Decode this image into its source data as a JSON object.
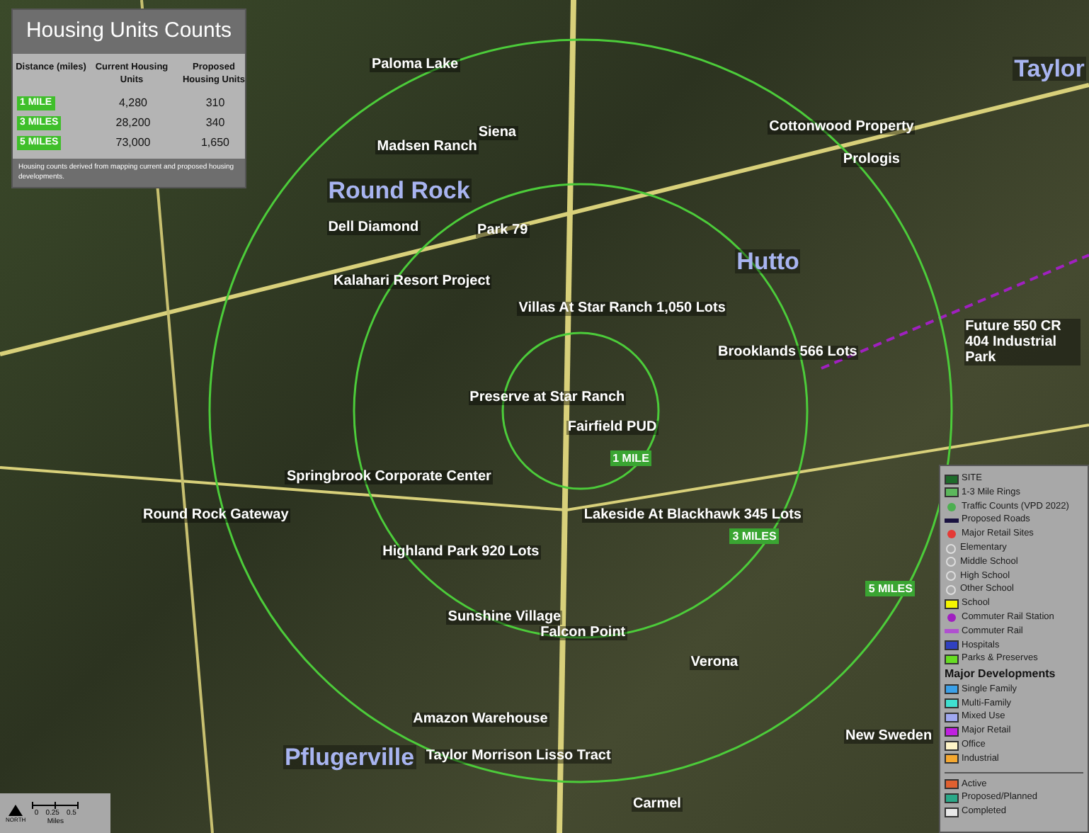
{
  "summary": {
    "title": "Housing Units Counts",
    "columns": [
      "Distance (miles)",
      "Current Housing Units",
      "Proposed Housing Units"
    ],
    "rows": [
      {
        "distance": "1 MILE",
        "current": "4,280",
        "proposed": "310"
      },
      {
        "distance": "3 MILES",
        "current": "28,200",
        "proposed": "340"
      },
      {
        "distance": "5 MILES",
        "current": "73,000",
        "proposed": "1,650"
      }
    ],
    "note": "Housing counts derived from mapping current and proposed housing developments."
  },
  "map": {
    "cities": [
      "Taylor",
      "Round Rock",
      "Hutto",
      "Pflugerville"
    ],
    "rings": [
      "1 MILE",
      "3 MILES",
      "5 MILES"
    ],
    "places": [
      "Paloma Lake",
      "Siena",
      "Cottonwood Property",
      "Madsen Ranch",
      "Prologis",
      "Dell Diamond",
      "Park 79",
      "Kalahari Resort Project",
      "Villas At Star Ranch 1,050 Lots",
      "Brooklands 566 Lots",
      "Future 550 CR 404 Industrial Park",
      "Preserve at Star Ranch",
      "Fairfield PUD",
      "Springbrook Corporate Center",
      "Round Rock Gateway",
      "Lakeside At Blackhawk 345 Lots",
      "Highland Park 920 Lots",
      "Sunshine Village",
      "Falcon Point",
      "Verona",
      "Amazon Warehouse",
      "New Sweden",
      "Taylor Morrison Lisso Tract",
      "Carmel"
    ]
  },
  "legend": {
    "items": [
      {
        "kind": "box",
        "label": "SITE",
        "color": "#1d6b2a"
      },
      {
        "kind": "box",
        "label": "1-3 Mile Rings",
        "color": "#5cb85c"
      },
      {
        "kind": "dot",
        "label": "Traffic Counts (VPD 2022)",
        "color": "#4caf50"
      },
      {
        "kind": "line",
        "label": "Proposed Roads",
        "color": "#1a1240"
      },
      {
        "kind": "dot",
        "label": "Major Retail Sites",
        "color": "#e53935"
      },
      {
        "kind": "glyph",
        "label": "Elementary",
        "color": "#dddddd"
      },
      {
        "kind": "glyph",
        "label": "Middle School",
        "color": "#dddddd"
      },
      {
        "kind": "glyph",
        "label": "High School",
        "color": "#dddddd"
      },
      {
        "kind": "glyph",
        "label": "Other School",
        "color": "#dddddd"
      },
      {
        "kind": "box",
        "label": "School",
        "color": "#f5f500"
      },
      {
        "kind": "dot",
        "label": "Commuter Rail Station",
        "color": "#a020c0"
      },
      {
        "kind": "line",
        "label": "Commuter Rail",
        "color": "#b050d0"
      },
      {
        "kind": "box",
        "label": "Hospitals",
        "color": "#3040c0"
      },
      {
        "kind": "box",
        "label": "Parks & Preserves",
        "color": "#66dd22"
      },
      {
        "kind": "heading",
        "label": "Major Developments",
        "color": "#111111"
      },
      {
        "kind": "box",
        "label": "Single Family",
        "color": "#3aa0e8"
      },
      {
        "kind": "box",
        "label": "Multi-Family",
        "color": "#40e0d0"
      },
      {
        "kind": "box",
        "label": "Mixed Use",
        "color": "#a0a8f0"
      },
      {
        "kind": "box",
        "label": "Major Retail",
        "color": "#c020e0"
      },
      {
        "kind": "box",
        "label": "Office",
        "color": "#fff5c8"
      },
      {
        "kind": "box",
        "label": "Industrial",
        "color": "#f5a830"
      },
      {
        "kind": "divider",
        "label": "Active",
        "color": "#e06030"
      },
      {
        "kind": "box",
        "label": "Proposed/Planned",
        "color": "#2aa888"
      },
      {
        "kind": "box",
        "label": "Completed",
        "color": "#e8e8e8"
      }
    ]
  },
  "scale": {
    "north": "NORTH",
    "ticks": [
      "0",
      "0.25",
      "0.5"
    ],
    "unit": "Miles"
  }
}
